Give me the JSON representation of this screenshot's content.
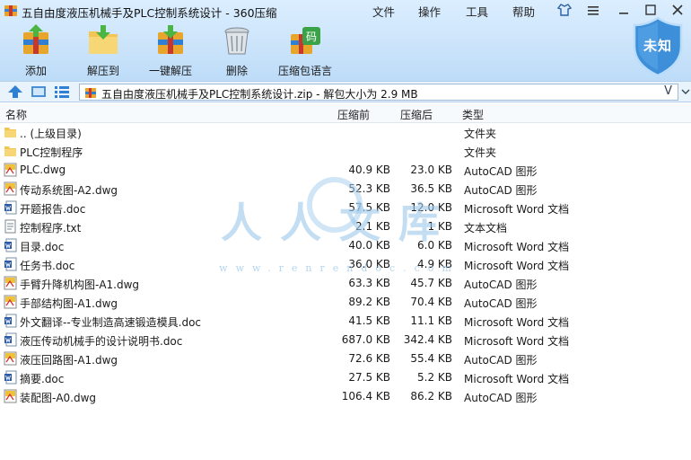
{
  "window": {
    "title": "五自由度液压机械手及PLC控制系统设计 - 360压缩",
    "menus": [
      "文件",
      "操作",
      "工具",
      "帮助"
    ]
  },
  "toolbar": {
    "buttons": [
      {
        "label": "添加",
        "icon": "add-archive-icon"
      },
      {
        "label": "解压到",
        "icon": "extract-to-icon"
      },
      {
        "label": "一键解压",
        "icon": "one-click-extract-icon"
      },
      {
        "label": "删除",
        "icon": "delete-bin-icon"
      },
      {
        "label": "压缩包语言",
        "icon": "archive-language-icon"
      }
    ],
    "language_glyph": "码",
    "badge_text": "未知"
  },
  "address": {
    "path": "五自由度液压机械手及PLC控制系统设计.zip - 解包大小为 2.9 MB",
    "dropdown": "V"
  },
  "columns": {
    "name": "名称",
    "packed": "压缩前",
    "unpacked": "压缩后",
    "type": "类型"
  },
  "files": [
    {
      "name": ".. (上级目录)",
      "packed": "",
      "unpacked": "",
      "type": "文件夹",
      "icon": "folder-icon"
    },
    {
      "name": "PLC控制程序",
      "packed": "",
      "unpacked": "",
      "type": "文件夹",
      "icon": "folder-icon"
    },
    {
      "name": "PLC.dwg",
      "packed": "40.9 KB",
      "unpacked": "23.0 KB",
      "type": "AutoCAD 图形",
      "icon": "dwg-file-icon"
    },
    {
      "name": "传动系统图-A2.dwg",
      "packed": "52.3 KB",
      "unpacked": "36.5 KB",
      "type": "AutoCAD 图形",
      "icon": "dwg-file-icon"
    },
    {
      "name": "开题报告.doc",
      "packed": "57.5 KB",
      "unpacked": "12.0 KB",
      "type": "Microsoft Word 文档",
      "icon": "word-doc-icon"
    },
    {
      "name": "控制程序.txt",
      "packed": "2.1 KB",
      "unpacked": "1 KB",
      "type": "文本文档",
      "icon": "text-file-icon"
    },
    {
      "name": "目录.doc",
      "packed": "40.0 KB",
      "unpacked": "6.0 KB",
      "type": "Microsoft Word 文档",
      "icon": "word-doc-icon"
    },
    {
      "name": "任务书.doc",
      "packed": "36.0 KB",
      "unpacked": "4.9 KB",
      "type": "Microsoft Word 文档",
      "icon": "word-doc-icon"
    },
    {
      "name": "手臂升降机构图-A1.dwg",
      "packed": "63.3 KB",
      "unpacked": "45.7 KB",
      "type": "AutoCAD 图形",
      "icon": "dwg-file-icon"
    },
    {
      "name": "手部结构图-A1.dwg",
      "packed": "89.2 KB",
      "unpacked": "70.4 KB",
      "type": "AutoCAD 图形",
      "icon": "dwg-file-icon"
    },
    {
      "name": "外文翻译--专业制造高速锻造模具.doc",
      "packed": "41.5 KB",
      "unpacked": "11.1 KB",
      "type": "Microsoft Word 文档",
      "icon": "word-doc-icon"
    },
    {
      "name": "液压传动机械手的设计说明书.doc",
      "packed": "687.0 KB",
      "unpacked": "342.4 KB",
      "type": "Microsoft Word 文档",
      "icon": "word-doc-icon"
    },
    {
      "name": "液压回路图-A1.dwg",
      "packed": "72.6 KB",
      "unpacked": "55.4 KB",
      "type": "AutoCAD 图形",
      "icon": "dwg-file-icon"
    },
    {
      "name": "摘要.doc",
      "packed": "27.5 KB",
      "unpacked": "5.2 KB",
      "type": "Microsoft Word 文档",
      "icon": "word-doc-icon"
    },
    {
      "name": "装配图-A0.dwg",
      "packed": "106.4 KB",
      "unpacked": "86.2 KB",
      "type": "AutoCAD 图形",
      "icon": "dwg-file-icon"
    }
  ],
  "watermark": {
    "text": "人人文库",
    "url": "www.renrendoc.com"
  },
  "colors": {
    "accent": "#2f7fd3",
    "badge": "#3d8fd9",
    "folder": "#f3c552"
  }
}
